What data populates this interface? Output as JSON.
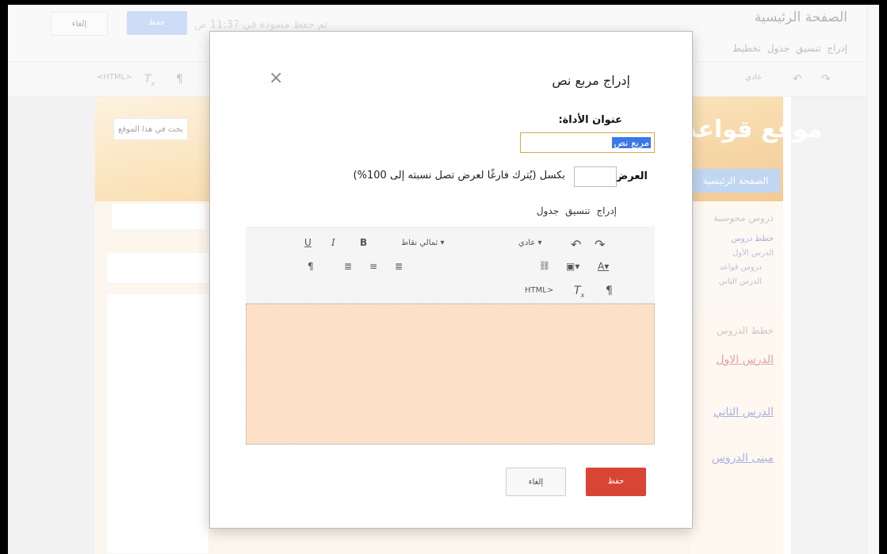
{
  "background": {
    "cancel_label": "إلغاء",
    "save_label": "حفظ",
    "status_text": "تم حفظ مسودة في 11:37 ص",
    "page_title": "الصفحة الرئيسية",
    "menu": [
      "إدراج",
      "تنسيق",
      "جدول",
      "تخطيط"
    ],
    "toolbar": {
      "html_label": "<HTML>",
      "format_label": "عادي"
    },
    "site": {
      "search_button": "بحث في هذا الموقع",
      "title": "موقع قواعد",
      "nav_home": "الصفحة الرئيسية",
      "sidebar_heading": "دروس محوسبة",
      "sidebar_items": [
        "خطط دروس",
        "الدرس الأول",
        "دروس قواعد",
        "الدرس الثاني"
      ],
      "lessons_heading": "خطط الدروس",
      "links": [
        "الدرس الاول",
        "الدرس الثاني",
        "مبنى الدروس"
      ]
    }
  },
  "dialog": {
    "title": "إدراج مربع نص",
    "close_symbol": "×",
    "gadget_title_label": "عنوان الأداة:",
    "gadget_title_value": "مربع نص",
    "width_label": "العرض:",
    "width_value": "",
    "width_hint": "بكسل (يُترك فارغًا لعرض تصل نسبته إلى 100%)",
    "editor_menu": [
      "إدراج",
      "تنسيق",
      "جدول"
    ],
    "editor_toolbar": {
      "format_label": "عادي",
      "font_label": "ثمالي نقاط",
      "bold": "B",
      "italic": "I",
      "underline": "U",
      "html_label": "HTML>"
    },
    "save_label": "حفظ",
    "cancel_label": "إلغاء"
  }
}
